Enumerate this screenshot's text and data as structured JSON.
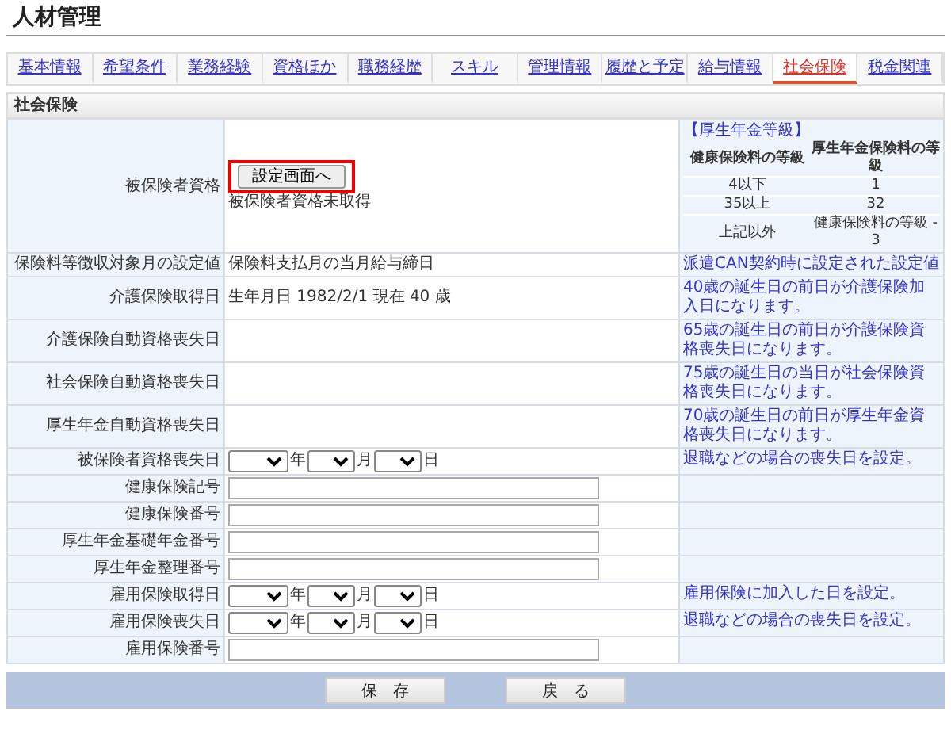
{
  "title": "人材管理",
  "tabs": [
    {
      "label": "基本情報",
      "selected": false
    },
    {
      "label": "希望条件",
      "selected": false
    },
    {
      "label": "業務経験",
      "selected": false
    },
    {
      "label": "資格ほか",
      "selected": false
    },
    {
      "label": "職務経歴",
      "selected": false
    },
    {
      "label": "スキル",
      "selected": false
    },
    {
      "label": "管理情報",
      "selected": false
    },
    {
      "label": "履歴と予定",
      "selected": false
    },
    {
      "label": "給与情報",
      "selected": false
    },
    {
      "label": "社会保険",
      "selected": true
    },
    {
      "label": "税金関連",
      "selected": false
    }
  ],
  "section_title": "社会保険",
  "grade_table": {
    "heading": "【厚生年金等級】",
    "columns": [
      "健康保険料の等級",
      "厚生年金保険料の等級"
    ],
    "rows": [
      [
        "4以下",
        "1"
      ],
      [
        "35以上",
        "32"
      ],
      [
        "上記以外",
        "健康保険料の等級 - 3"
      ]
    ]
  },
  "rows": [
    {
      "label": "被保険者資格",
      "kind": "setup",
      "button": "設定画面へ",
      "highlighted": true,
      "value": "被保険者資格未取得"
    },
    {
      "label": "保険料等徴収対象月の設定値",
      "kind": "text",
      "value": "保険料支払月の当月給与締日",
      "note": "派遣CAN契約時に設定された設定値"
    },
    {
      "label": "介護保険取得日",
      "kind": "text",
      "value": "生年月日 1982/2/1 現在 40 歳",
      "note": "40歳の誕生日の前日が介護保険加入日になります。"
    },
    {
      "label": "介護保険自動資格喪失日",
      "kind": "text",
      "note": "65歳の誕生日の前日が介護保険資格喪失日になります。"
    },
    {
      "label": "社会保険自動資格喪失日",
      "kind": "text",
      "note": "75歳の誕生日の当日が社会保険資格喪失日になります。"
    },
    {
      "label": "厚生年金自動資格喪失日",
      "kind": "text",
      "note": "70歳の誕生日の前日が厚生年金資格喪失日になります。"
    },
    {
      "label": "被保険者資格喪失日",
      "kind": "date",
      "units": [
        "年",
        "月",
        "日"
      ],
      "note": "退職などの場合の喪失日を設定。"
    },
    {
      "label": "健康保険記号",
      "kind": "input"
    },
    {
      "label": "健康保険番号",
      "kind": "input"
    },
    {
      "label": "厚生年金基礎年金番号",
      "kind": "input"
    },
    {
      "label": "厚生年金整理番号",
      "kind": "input"
    },
    {
      "label": "雇用保険取得日",
      "kind": "date",
      "units": [
        "年",
        "月",
        "日"
      ],
      "note": "雇用保険に加入した日を設定。"
    },
    {
      "label": "雇用保険喪失日",
      "kind": "date",
      "units": [
        "年",
        "月",
        "日"
      ],
      "note": "退職などの場合の喪失日を設定。"
    },
    {
      "label": "雇用保険番号",
      "kind": "input"
    }
  ],
  "buttons": [
    "保　存",
    "戻　る"
  ]
}
